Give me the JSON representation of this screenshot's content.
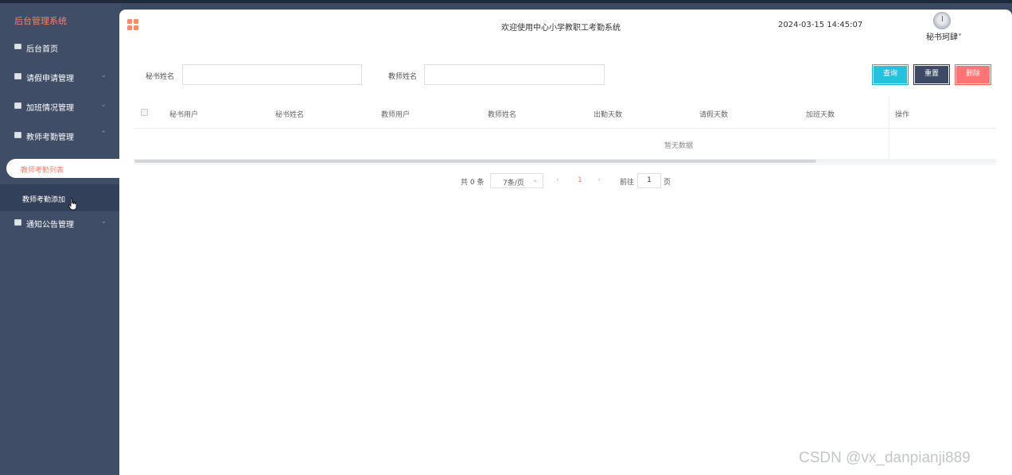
{
  "app": {
    "brand": "后台管理系统"
  },
  "sidebar": {
    "items": [
      {
        "label": "后台首页",
        "arrow": ""
      },
      {
        "label": "请假申请管理",
        "arrow": "⌄"
      },
      {
        "label": "加班情况管理",
        "arrow": "⌄"
      },
      {
        "label": "教师考勤管理",
        "arrow": "⌃"
      },
      {
        "label": "通知公告管理",
        "arrow": "⌄"
      }
    ],
    "sub_items": [
      {
        "label": "教师考勤列表"
      },
      {
        "label": "教师考勤添加"
      }
    ]
  },
  "header": {
    "welcome": "欢迎使用中心小学教职工考勤系统",
    "datetime": "2024-03-15 14:45:07",
    "username": "秘书珂肆˅"
  },
  "search": {
    "secretary_name_label": "秘书姓名",
    "secretary_name_value": "",
    "teacher_name_label": "教师姓名",
    "teacher_name_value": "",
    "query_label": "查询",
    "reset_label": "重置",
    "delete_label": "删除"
  },
  "table": {
    "columns": [
      "秘书用户",
      "秘书姓名",
      "教师用户",
      "教师姓名",
      "出勤天数",
      "请假天数",
      "加班天数",
      "操作"
    ],
    "empty_text": "暂无数据"
  },
  "pagination": {
    "total": "共 0 条",
    "page_size": "7条/页",
    "prev": "‹",
    "current": "1",
    "next": "›",
    "goto": "前往",
    "goto_value": "1",
    "page_unit": "页"
  },
  "watermark": "CSDN @vx_danpianji889",
  "colors": {
    "sidebar_bg": "#3f4d67",
    "accent": "#ff7f66",
    "query": "#23c3e0",
    "reset": "#3c4a62",
    "delete": "#ff7373"
  }
}
